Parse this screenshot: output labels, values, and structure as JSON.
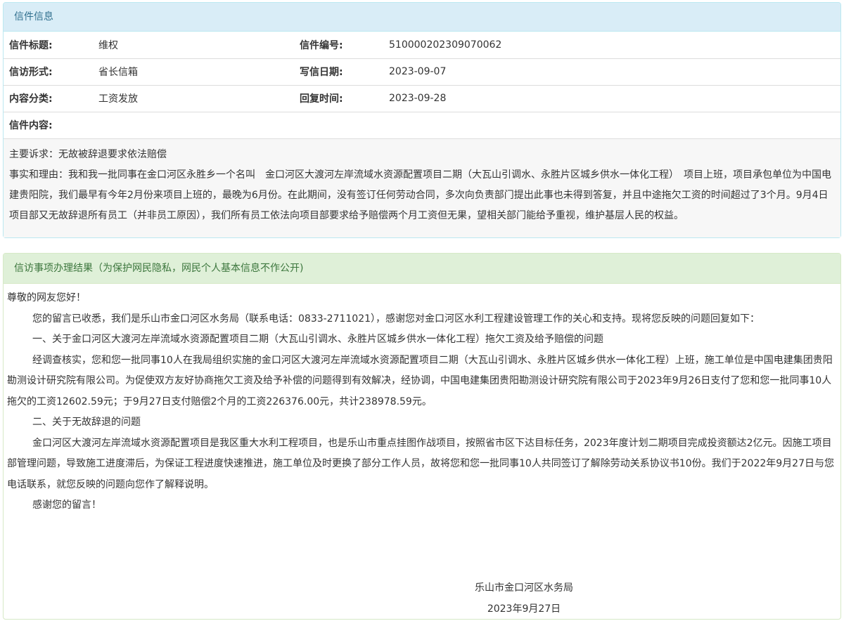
{
  "letter_panel": {
    "heading": "信件信息",
    "rows": [
      {
        "label1": "信件标题:",
        "value1": "维权",
        "label2": "信件编号:",
        "value2": "510000202309070062"
      },
      {
        "label1": "信访形式:",
        "value1": "省长信箱",
        "label2": "写信日期:",
        "value2": "2023-09-07"
      },
      {
        "label1": "内容分类:",
        "value1": "工资发放",
        "label2": "回复时间:",
        "value2": "2023-09-28"
      }
    ],
    "content_label": "信件内容:",
    "content_lines": [
      "主要诉求：无故被辞退要求依法赔偿",
      "事实和理由：我和我一批同事在金口河区永胜乡一个名叫　金口河区大渡河左岸流域水资源配置项目二期（大瓦山引调水、永胜片区城乡供水一体化工程）　项目上班，项目承包单位为中国电建贵阳院，我们最早有今年2月份来项目上班的，最晚为6月份。在此期间，没有签订任何劳动合同，多次向负责部门提出此事也未得到答复，并且中途拖欠工资的时间超过了3个月。9月4日项目部又无故辞退所有员工（并非员工原因），我们所有员工依法向项目部要求给予赔偿两个月工资但无果，望相关部门能给予重视，维护基层人民的权益。"
    ]
  },
  "result_panel": {
    "heading": "信访事项办理结果（为保护网民隐私，网民个人基本信息不作公开)",
    "greeting": "尊敬的网友您好！",
    "paragraphs": [
      "您的留言已收悉，我们是乐山市金口河区水务局（联系电话：0833-2711021），感谢您对金口河区水利工程建设管理工作的关心和支持。现将您反映的问题回复如下：",
      "一、关于金口河区大渡河左岸流域水资源配置项目二期（大瓦山引调水、永胜片区城乡供水一体化工程）拖欠工资及给予赔偿的问题",
      "经调查核实，您和您一批同事10人在我局组织实施的金口河区大渡河左岸流域水资源配置项目二期（大瓦山引调水、永胜片区城乡供水一体化工程）上班，施工单位是中国电建集团贵阳勘测设计研究院有限公司。为促使双方友好协商拖欠工资及给予补偿的问题得到有效解决，经协调，中国电建集团贵阳勘测设计研究院有限公司于2023年9月26日支付了您和您一批同事10人拖欠的工资12602.59元；于9月27日支付赔偿2个月的工资226376.00元，共计238978.59元。",
      "二、关于无故辞退的问题",
      "金口河区大渡河左岸流域水资源配置项目是我区重大水利工程项目，也是乐山市重点挂图作战项目，按照省市区下达目标任务，2023年度计划二期项目完成投资额达2亿元。因施工项目部管理问题，导致施工进度滞后，为保证工程进度快速推进，施工单位及时更换了部分工作人员，故将您和您一批同事10人共同签订了解除劳动关系协议书10份。我们于2022年9月27日与您电话联系，就您反映的问题向您作了解释说明。",
      "感谢您的留言！"
    ],
    "signature_org": "乐山市金口河区水务局",
    "signature_date": "2023年9月27日"
  }
}
